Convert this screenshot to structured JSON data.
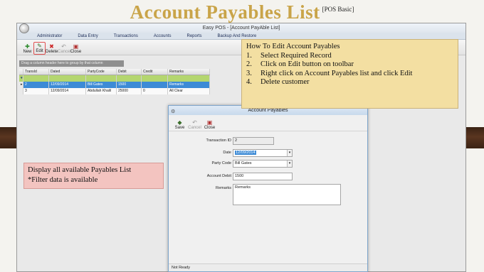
{
  "slide": {
    "title": "Account Payables List",
    "subtitle": "[POS Basic]"
  },
  "app": {
    "window_title": "Easy POS - [Account PayAble List]",
    "menu": [
      "Administrator",
      "Data Entry",
      "Transactions",
      "Accounts",
      "Reports",
      "Backup And Restore"
    ],
    "toolbar": [
      {
        "label": "New",
        "icon": "new-icon",
        "glyph": "✚",
        "enabled": true
      },
      {
        "label": "Edit",
        "icon": "edit-icon",
        "glyph": "✎",
        "enabled": true
      },
      {
        "label": "Delete",
        "icon": "delete-icon",
        "glyph": "✖",
        "enabled": true
      },
      {
        "label": "Cancel",
        "icon": "cancel-icon",
        "glyph": "↶",
        "enabled": false
      },
      {
        "label": "Close",
        "icon": "close-icon",
        "glyph": "▣",
        "enabled": true
      }
    ],
    "group_hint": "Drag a column header here to group by that column",
    "grid": {
      "columns": [
        "TransId",
        "Dated",
        "PartyCode",
        "Debit",
        "Credit",
        "Remarks"
      ],
      "rows": [
        [
          "2",
          "12/09/2014",
          "Bill Gates",
          "1500",
          "",
          "Remarks"
        ],
        [
          "3",
          "12/09/2014",
          "Abdullah Khalil",
          "25000",
          "0",
          "All Clear"
        ]
      ]
    }
  },
  "dialog": {
    "title": "Account Payables",
    "toolbar": [
      {
        "label": "Save",
        "icon": "save-icon",
        "glyph": "◆",
        "enabled": true
      },
      {
        "label": "Cancel",
        "icon": "cancel-icon",
        "glyph": "↶",
        "enabled": false
      },
      {
        "label": "Close",
        "icon": "close-icon",
        "glyph": "▣",
        "enabled": true
      }
    ],
    "fields": {
      "transaction_id": {
        "label": "Transaction ID",
        "value": "2"
      },
      "date": {
        "label": "Date",
        "value": "12/09/2014"
      },
      "party_code": {
        "label": "Party Code",
        "value": "Bill Gates"
      },
      "account_debit": {
        "label": "Account Debit",
        "value": "1500"
      },
      "remarks": {
        "label": "Remarks",
        "value": "Remarks"
      }
    },
    "status": "Not Ready"
  },
  "notes": {
    "edit_title": "How To Edit Account Payables",
    "edit_steps": [
      {
        "n": "1.",
        "text": "Select Required Record"
      },
      {
        "n": "2.",
        "text": "Click on Edit button on toolbar"
      },
      {
        "n": "3.",
        "text": "Right click on Account Payables list and click Edit"
      },
      {
        "n": "4.",
        "text": "Delete customer"
      }
    ],
    "display_line1": "Display all available Payables List",
    "display_line2": "*Filter data is available"
  },
  "colors": {
    "title_gold": "#c9a449",
    "note_yellow": "#f3dfa2",
    "note_pink": "#f3c4c0",
    "selection_blue": "#3d8bd6",
    "filter_green": "#b4d66f"
  }
}
